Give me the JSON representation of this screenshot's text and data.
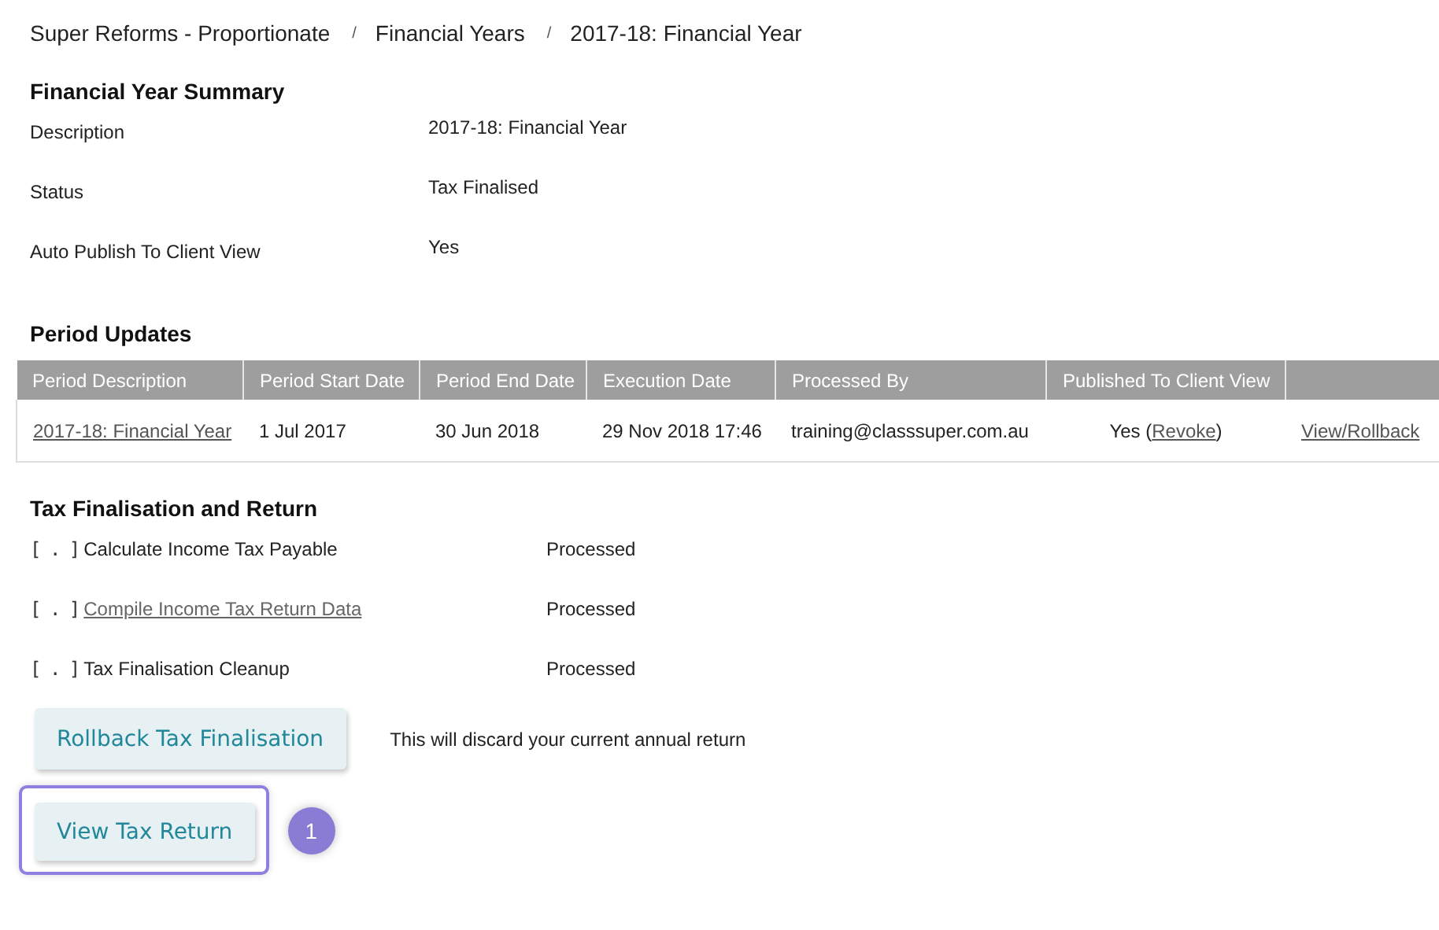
{
  "breadcrumb": [
    "Super Reforms - Proportionate",
    "Financial Years",
    "2017-18: Financial Year"
  ],
  "breadcrumb_separator": "/",
  "summary": {
    "title": "Financial Year Summary",
    "rows": [
      {
        "label": "Description",
        "value": "2017-18: Financial Year"
      },
      {
        "label": "Status",
        "value": "Tax Finalised"
      },
      {
        "label": "Auto Publish To Client View",
        "value": "Yes"
      }
    ]
  },
  "period_updates": {
    "title": "Period Updates",
    "columns": [
      "Period Description",
      "Period Start Date",
      "Period End Date",
      "Execution Date",
      "Processed By",
      "Published To Client View"
    ],
    "rows": [
      {
        "description": "2017-18: Financial Year",
        "start": "1 Jul 2017",
        "end": "30 Jun 2018",
        "executed": "29 Nov 2018 17:46",
        "processed_by": "training@classsuper.com.au",
        "published": "Yes (",
        "revoke_link": "Revoke",
        "published_end": ")",
        "action_link": "View/Rollback"
      }
    ]
  },
  "tax_finalisation": {
    "title": "Tax Finalisation and Return",
    "items": [
      {
        "marker": "[ . ]",
        "label": "Calculate Income Tax Payable",
        "kind": "text",
        "status": "Processed"
      },
      {
        "marker": "[ . ]",
        "label": "Compile Income Tax Return Data",
        "kind": "link",
        "status": "Processed"
      },
      {
        "marker": "[ . ]",
        "label": "Tax Finalisation Cleanup",
        "kind": "text",
        "status": "Processed"
      }
    ]
  },
  "actions": [
    {
      "label": "Rollback Tax Finalisation",
      "note": "This will discard your current annual return",
      "highlighted": false
    },
    {
      "label": "View Tax Return",
      "highlighted": true,
      "badge": "1"
    }
  ]
}
